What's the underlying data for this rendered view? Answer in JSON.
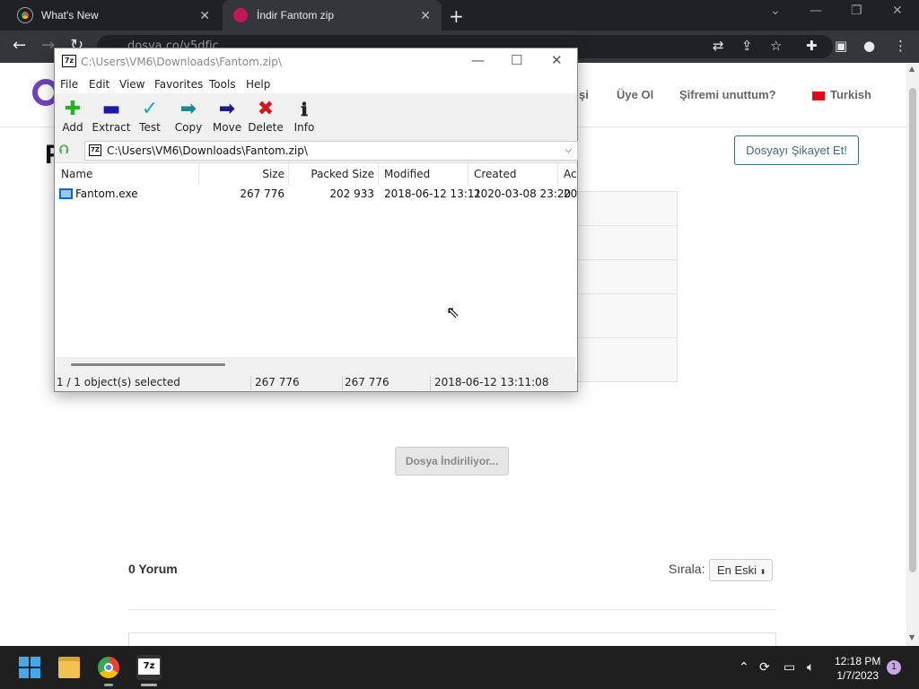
{
  "browser": {
    "tabs": [
      {
        "title": "What's New"
      },
      {
        "title": "İndir Fantom zip"
      }
    ],
    "url": "dosya.co/y5dfjc"
  },
  "website": {
    "nav": {
      "partial_login": "şi",
      "register": "Üye Ol",
      "forgot_password": "Şifremi unuttum?",
      "language": "Turkish"
    },
    "title_initial": "F",
    "report_button": "Dosyayı Şikayet Et!",
    "download_button": "Dosya İndiriliyor...",
    "comments_count": "0 Yorum",
    "sort_label": "Sırala:",
    "sort_value": "En Eski"
  },
  "zip_window": {
    "title": "C:\\Users\\VM6\\Downloads\\Fantom.zip\\",
    "menu": [
      "File",
      "Edit",
      "View",
      "Favorites",
      "Tools",
      "Help"
    ],
    "toolbar": [
      "Add",
      "Extract",
      "Test",
      "Copy",
      "Move",
      "Delete",
      "Info"
    ],
    "address": "C:\\Users\\VM6\\Downloads\\Fantom.zip\\",
    "columns": [
      "Name",
      "Size",
      "Packed Size",
      "Modified",
      "Created",
      "Ac"
    ],
    "files": [
      {
        "name": "Fantom.exe",
        "size": "267 776",
        "packed": "202 933",
        "modified": "2018-06-12 13:11",
        "created": "2020-03-08 23:20",
        "accessed": "202"
      }
    ],
    "status": {
      "selection": "1 / 1 object(s) selected",
      "size": "267 776",
      "size2": "267 776",
      "date": "2018-06-12 13:11:08"
    }
  },
  "taskbar": {
    "time": "12:18 PM",
    "date": "1/7/2023",
    "notification_count": "1"
  }
}
